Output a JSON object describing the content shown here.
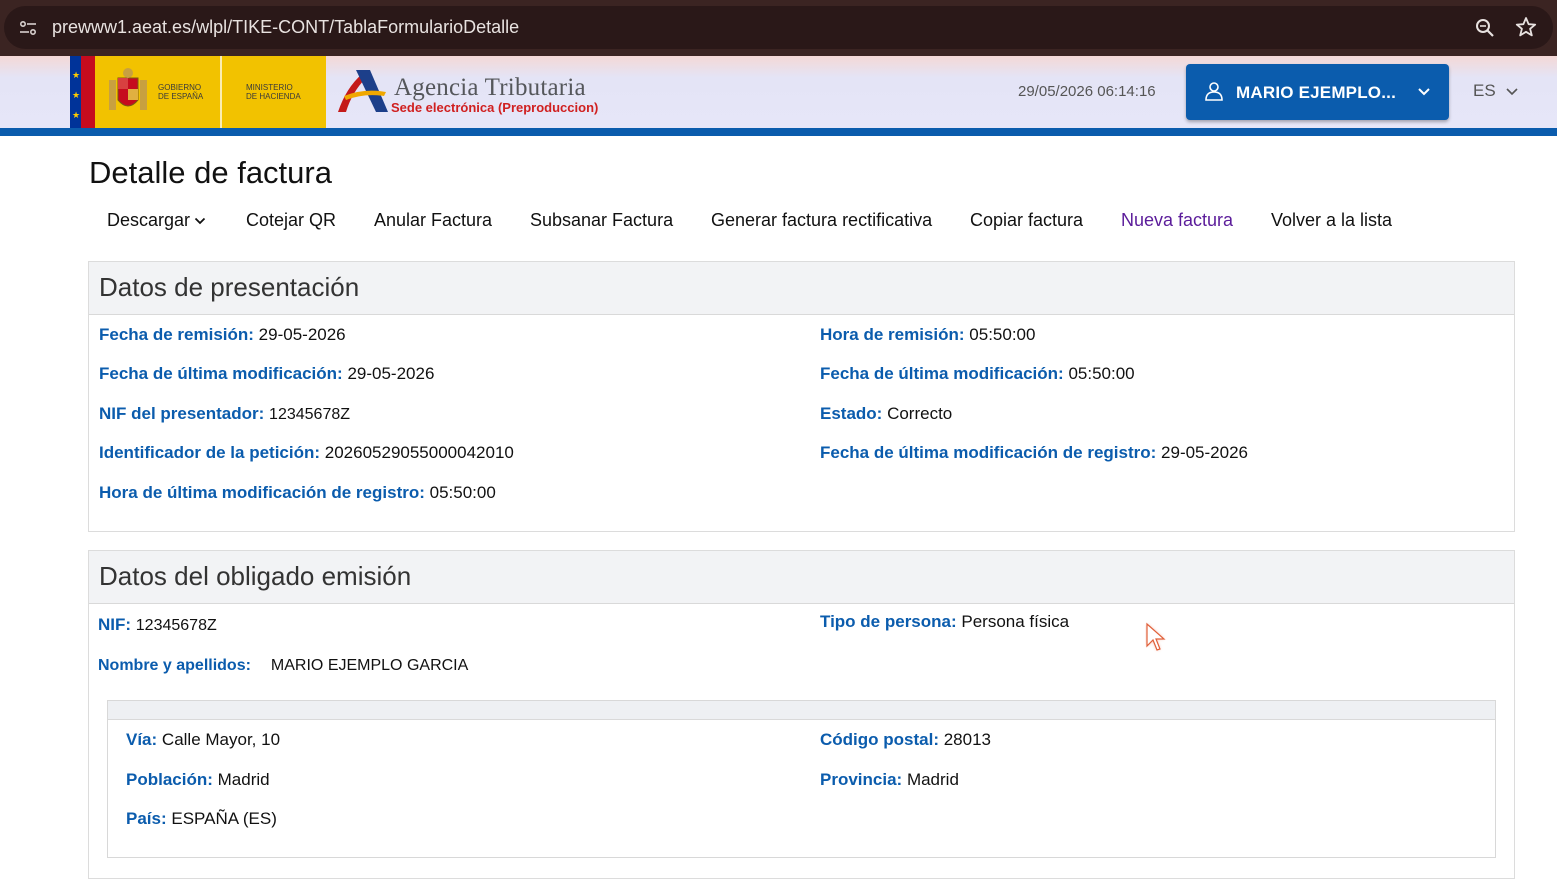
{
  "browser": {
    "url": "prewww1.aeat.es/wlpl/TIKE-CONT/TablaFormularioDetalle"
  },
  "header": {
    "gov_line1": "GOBIERNO",
    "gov_line2": "DE ESPAÑA",
    "min_line1": "MINISTERIO",
    "min_line2": "DE HACIENDA",
    "agency_title": "Agencia Tributaria",
    "agency_subtitle": "Sede electrónica (Preproduccion)",
    "timestamp": "29/05/2026 06:14:16",
    "user_name": "MARIO EJEMPLO...",
    "language": "ES",
    "accent_color": "#0b5cad"
  },
  "page": {
    "title": "Detalle de factura"
  },
  "toolbar": {
    "download": "Descargar",
    "match_qr": "Cotejar QR",
    "cancel_invoice": "Anular Factura",
    "fix_invoice": "Subsanar Factura",
    "rectify_invoice": "Generar factura rectificativa",
    "copy_invoice": "Copiar factura",
    "new_invoice": "Nueva factura",
    "back_to_list": "Volver a la lista"
  },
  "presentation": {
    "heading": "Datos de presentación",
    "fields": [
      {
        "label": "Fecha de remisión:",
        "value": "29-05-2026"
      },
      {
        "label": "Hora de remisión:",
        "value": "05:50:00"
      },
      {
        "label": "Fecha de última modificación:",
        "value": "29-05-2026"
      },
      {
        "label": "Fecha de última modificación:",
        "value": "05:50:00"
      },
      {
        "label": "NIF del presentador:",
        "value": "12345678Z"
      },
      {
        "label": "Estado:",
        "value": "Correcto"
      },
      {
        "label": "Identificador de la petición:",
        "value": "20260529055000042010"
      },
      {
        "label": "Fecha de última modificación de registro:",
        "value": "29-05-2026"
      },
      {
        "label": "Hora de última modificación de registro:",
        "value": "05:50:00"
      }
    ]
  },
  "issuer": {
    "heading": "Datos del obligado emisión",
    "fields": [
      {
        "label": "NIF:",
        "value": "12345678Z"
      },
      {
        "label": "Tipo de persona:",
        "value": "Persona física"
      },
      {
        "label": "Nombre y apellidos:",
        "value": "MARIO EJEMPLO GARCIA"
      }
    ],
    "address": [
      {
        "label": "Vía:",
        "value": "Calle Mayor, 10"
      },
      {
        "label": "Código postal:",
        "value": "28013"
      },
      {
        "label": "Población:",
        "value": "Madrid"
      },
      {
        "label": "Provincia:",
        "value": "Madrid"
      },
      {
        "label": "País:",
        "value": "ESPAÑA (ES)"
      }
    ]
  }
}
